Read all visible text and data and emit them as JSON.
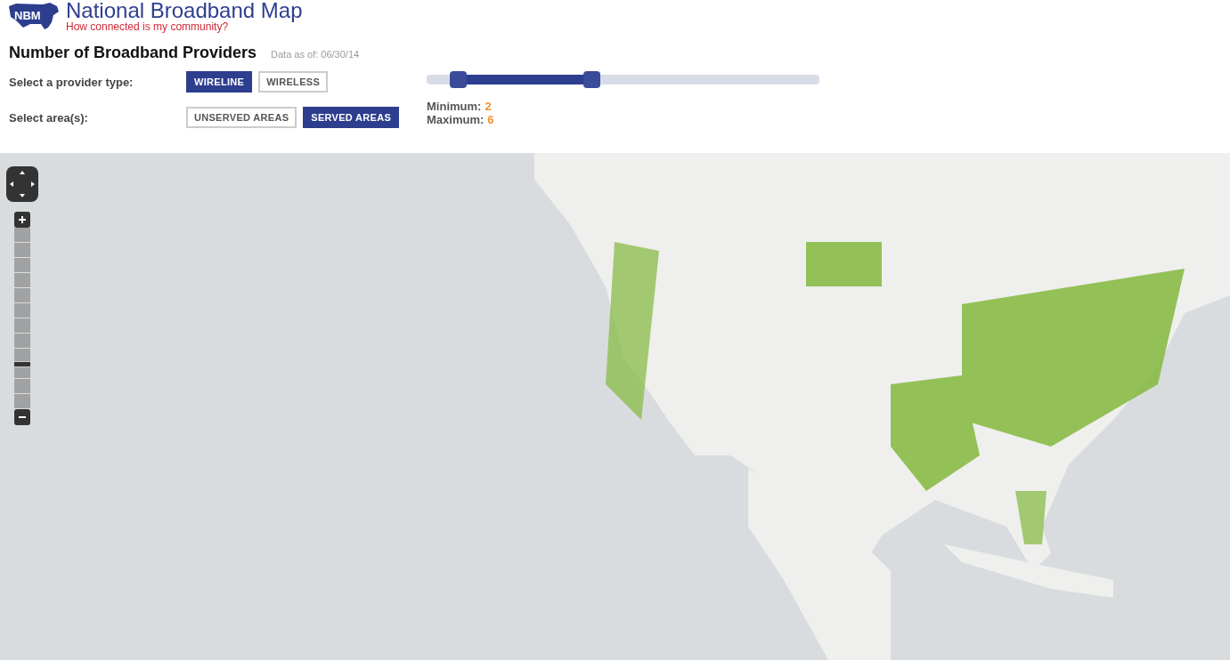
{
  "header": {
    "logo": "NBM",
    "title": "National Broadband Map",
    "tagline": "How connected is my community?"
  },
  "heading": {
    "title": "Number of Broadband Providers",
    "date": "Data as of: 06/30/14"
  },
  "provider_type": {
    "label": "Select a provider type:",
    "options": [
      {
        "label": "WIRELINE",
        "selected": true
      },
      {
        "label": "WIRELESS",
        "selected": false
      }
    ]
  },
  "areas": {
    "label": "Select area(s):",
    "options": [
      {
        "label": "UNSERVED AREAS",
        "selected": false
      },
      {
        "label": "SERVED AREAS",
        "selected": true
      }
    ]
  },
  "range": {
    "low": {
      "level": 0.08
    },
    "high": {
      "level": 0.42
    },
    "minimum_label": "Minimum:",
    "minimum": "2",
    "maximum_label": "Maximum:",
    "maximum": "6"
  },
  "map": {
    "zoom": {
      "level": 0.23
    }
  }
}
